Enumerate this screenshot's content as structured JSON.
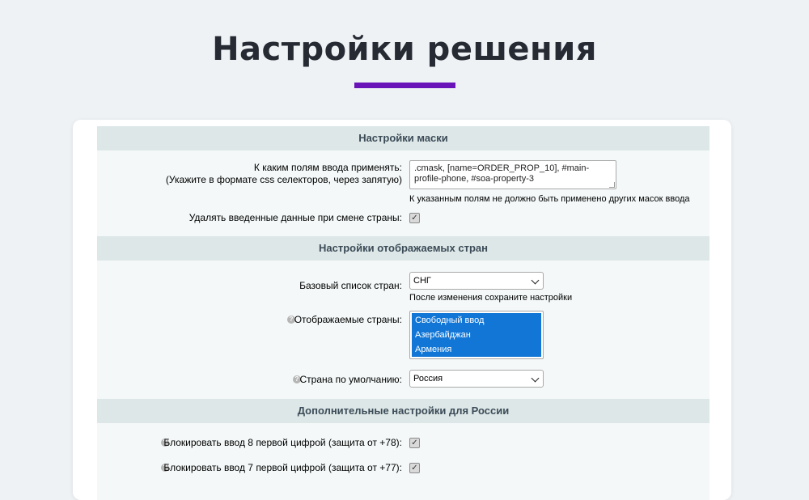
{
  "page": {
    "title": "Настройки решения"
  },
  "sections": {
    "mask": {
      "title": "Настройки маски"
    },
    "countries": {
      "title": "Настройки отображаемых стран"
    },
    "russia": {
      "title": "Дополнительные настройки для России"
    }
  },
  "mask": {
    "fields_label_line1": "К каким полям ввода применять:",
    "fields_label_line2": "(Укажите в формате css селекторов, через запятую)",
    "fields_value": ".cmask, [name=ORDER_PROP_10], #main-profile-phone, #soa-property-3",
    "fields_note": "К указанным полям не должно быть применено других масок ввода",
    "clear_on_change_label": "Удалять введенные данные при смене страны:",
    "clear_on_change_checked": true
  },
  "countries": {
    "base_list_label": "Базовый список стран:",
    "base_list_value": "СНГ",
    "base_list_note": "После изменения сохраните настройки",
    "displayed_label": "Отображаемые страны:",
    "displayed_options": [
      "Свободный ввод",
      "Азербайджан",
      "Армения"
    ],
    "default_label": "Страна по умолчанию:",
    "default_value": "Россия"
  },
  "russia": {
    "block8_label": "Блокировать ввод 8 первой цифрой (защита от +78):",
    "block8_checked": true,
    "block7_label": "Блокировать ввод 7 первой цифрой (защита от +77):",
    "block7_checked": true
  },
  "icons": {
    "hint": "question-icon",
    "checkbox_mark": "✓"
  },
  "colors": {
    "accent": "#6a13b8",
    "section_header_bg": "#dde7e7",
    "selected_option_bg": "#1176d6"
  }
}
